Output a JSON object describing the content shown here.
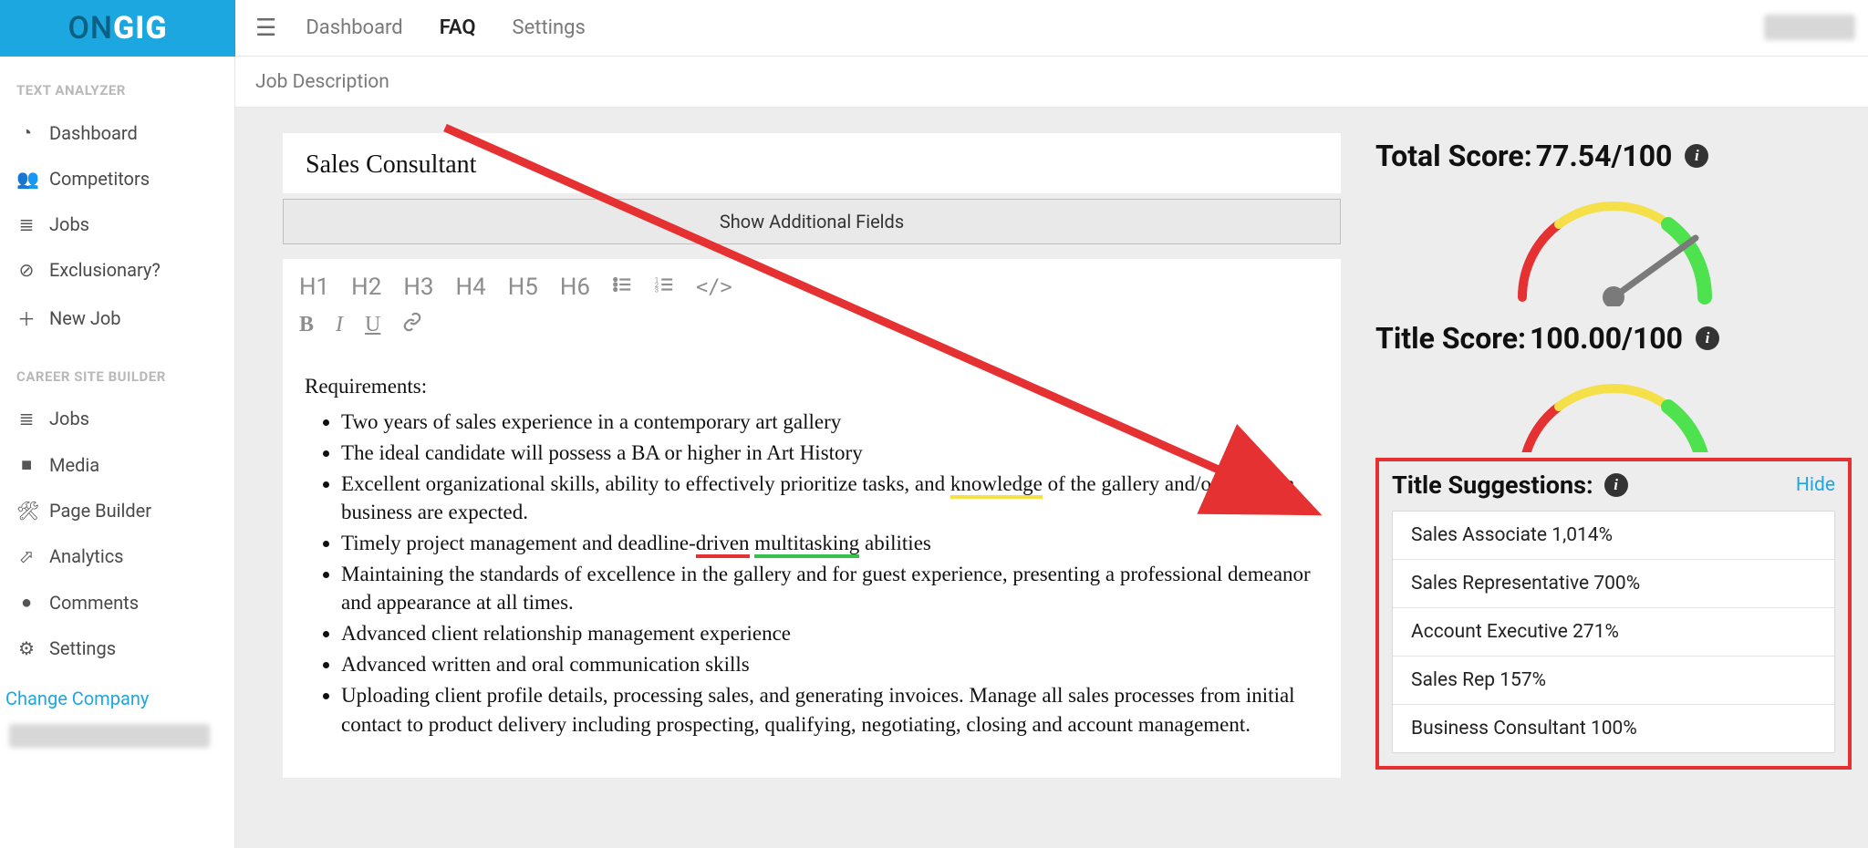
{
  "brand": {
    "first": "ON",
    "second": "GIG"
  },
  "sidebar": {
    "section1_title": "TEXT ANALYZER",
    "section1_items": [
      {
        "icon": "gauge-icon",
        "label": "Dashboard"
      },
      {
        "icon": "people-icon",
        "label": "Competitors"
      },
      {
        "icon": "list-icon",
        "label": "Jobs"
      },
      {
        "icon": "ban-icon",
        "label": "Exclusionary?"
      },
      {
        "icon": "plus-icon",
        "label": "New Job"
      }
    ],
    "section2_title": "CAREER SITE BUILDER",
    "section2_items": [
      {
        "icon": "list-icon",
        "label": "Jobs"
      },
      {
        "icon": "video-icon",
        "label": "Media"
      },
      {
        "icon": "hammer-icon",
        "label": "Page Builder"
      },
      {
        "icon": "chart-icon",
        "label": "Analytics"
      },
      {
        "icon": "chat-icon",
        "label": "Comments"
      },
      {
        "icon": "gear-icon",
        "label": "Settings"
      }
    ],
    "change_company": "Change Company"
  },
  "topnav": {
    "items": [
      "Dashboard",
      "FAQ",
      "Settings"
    ],
    "active_index": 1
  },
  "breadcrumb": "Job Description",
  "job": {
    "title": "Sales Consultant",
    "show_fields_label": "Show Additional Fields",
    "requirements_heading": "Requirements:",
    "bullets": [
      [
        {
          "t": "Two years of sales experience in a contemporary art gallery"
        }
      ],
      [
        {
          "t": "The ideal candidate will possess a BA or higher in Art History"
        }
      ],
      [
        {
          "t": "Excellent organizational skills, ability to effectively prioritize tasks, and "
        },
        {
          "t": "knowledge",
          "hl": "yellow"
        },
        {
          "t": " of the gallery and/or museum business are expected."
        }
      ],
      [
        {
          "t": "Timely project management and deadline-"
        },
        {
          "t": "driven",
          "hl": "red"
        },
        {
          "t": " "
        },
        {
          "t": "multitasking",
          "hl": "green"
        },
        {
          "t": " abilities"
        }
      ],
      [
        {
          "t": "Maintaining the standards of excellence in the gallery and for guest experience, presenting a professional demeanor and appearance at all times."
        }
      ],
      [
        {
          "t": "Advanced client relationship management experience"
        }
      ],
      [
        {
          "t": "Advanced written and oral communication skills"
        }
      ],
      [
        {
          "t": "Uploading client profile details, processing sales, and generating invoices. Manage all sales processes from initial contact to product delivery including prospecting, qualifying, negotiating, closing and account management."
        }
      ]
    ]
  },
  "toolbar": {
    "h1": "H1",
    "h2": "H2",
    "h3": "H3",
    "h4": "H4",
    "h5": "H5",
    "h6": "H6",
    "ul": "≔",
    "ol": "≕",
    "code": "</>",
    "bold": "B",
    "italic": "I",
    "underline": "U",
    "link": "🔗"
  },
  "scores": {
    "total_label": "Total Score: ",
    "total_value": "77.54/100",
    "title_label": "Title Score: ",
    "title_value": "100.00/100",
    "gauge": {
      "total_angle_deg": 120,
      "title_angle_deg": 178
    }
  },
  "suggestions": {
    "header": "Title Suggestions:",
    "hide_label": "Hide",
    "items": [
      "Sales Associate 1,014%",
      "Sales Representative 700%",
      "Account Executive 271%",
      "Sales Rep 157%",
      "Business Consultant 100%"
    ]
  },
  "icons": {
    "gauge-icon": "◔",
    "people-icon": "👥",
    "list-icon": "≣",
    "ban-icon": "⊘",
    "plus-icon": "＋",
    "video-icon": "■",
    "hammer-icon": "🛠",
    "chart-icon": "⬀",
    "chat-icon": "●",
    "gear-icon": "⚙"
  }
}
